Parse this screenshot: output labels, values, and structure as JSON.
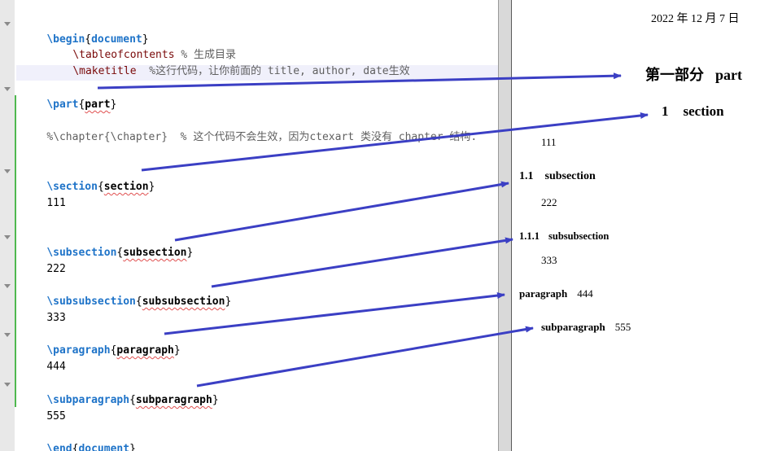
{
  "editor": {
    "lines": {
      "begin": {
        "cmd": "\\begin",
        "open": "{",
        "arg": "document",
        "close": "}"
      },
      "toc": {
        "cmd": "\\tableofcontents",
        "comment": " % 生成目录"
      },
      "maketitle": {
        "cmd": "\\maketitle",
        "comment": "  %这行代码，让你前面的 title, author, date生效"
      },
      "part": {
        "cmd": "\\part",
        "open": "{",
        "arg": "part",
        "close": "}"
      },
      "chapter_comment": "%\\chapter{\\chapter}  % 这个代码不会生效，因为ctexart 类没有 chapter 结构.",
      "section": {
        "cmd": "\\section",
        "open": "{",
        "arg": "section",
        "close": "}"
      },
      "section_text": "111",
      "subsection": {
        "cmd": "\\subsection",
        "open": "{",
        "arg": "subsection",
        "close": "}"
      },
      "subsection_text": "222",
      "subsubsection": {
        "cmd": "\\subsubsection",
        "open": "{",
        "arg": "subsubsection",
        "close": "}"
      },
      "subsubsection_text": "333",
      "paragraph": {
        "cmd": "\\paragraph",
        "open": "{",
        "arg": "paragraph",
        "close": "}"
      },
      "paragraph_text": "444",
      "subparagraph": {
        "cmd": "\\subparagraph",
        "open": "{",
        "arg": "subparagraph",
        "close": "}"
      },
      "subparagraph_text": "555",
      "end": {
        "cmd": "\\end",
        "open": "{",
        "arg": "document",
        "close": "}"
      }
    }
  },
  "preview": {
    "date": "2022 年 12 月 7 日",
    "part": {
      "label": "第一部分",
      "title": "part"
    },
    "section": {
      "number": "1",
      "title": "section",
      "body": "111"
    },
    "subsection": {
      "number": "1.1",
      "title": "subsection",
      "body": "222"
    },
    "subsubsection": {
      "number": "1.1.1",
      "title": "subsubsection",
      "body": "333"
    },
    "paragraph": {
      "title": "paragraph",
      "body": "444"
    },
    "subparagraph": {
      "title": "subparagraph",
      "body": "555"
    }
  },
  "colors": {
    "arrow": "#3b3fc4",
    "keyword": "#1e73c8",
    "scope_bar": "#4fb84f",
    "gutter": "#e8e8e8",
    "divider": "#d9d9d9"
  }
}
